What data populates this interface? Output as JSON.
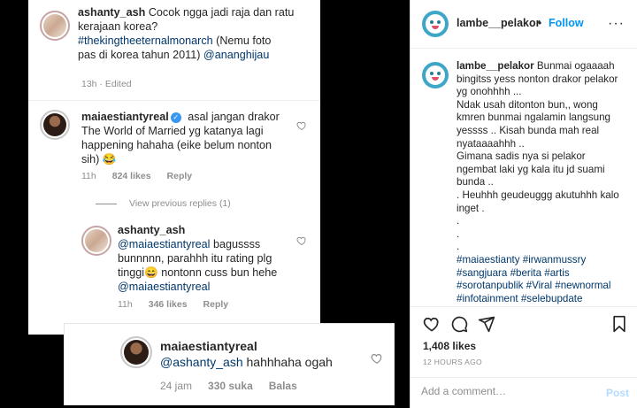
{
  "image_panel": {
    "comment1": {
      "username": "ashanty_ash",
      "text_line1": "Cocok ngga jadi raja dan ratu",
      "text_line2": "kerajaan korea?",
      "text_line3": "#thekingtheeternalmonarch",
      "text_line3b": "(Nemu foto",
      "text_line4": "pas di korea tahun 2011)",
      "mention": "@ananghijau",
      "meta": "13h · Edited"
    },
    "comment2": {
      "username": "maiaestiantyreal",
      "text_line1": "asal jangan drakor",
      "text_line2": "The World of Married yg katanya lagi",
      "text_line3": "happening hahaha (eike belum nonton",
      "text_line4": "sih) 😂",
      "time": "11h",
      "likes": "824 likes",
      "reply": "Reply"
    },
    "view_replies": "View previous replies (1)",
    "comment3": {
      "username": "ashanty_ash",
      "mention1": "@maiaestiantyreal",
      "text1": "bagussss",
      "text_line2": "bunnnnn, parahhh itu rating plg",
      "text_line3a": "tinggi😄",
      "text_line3b": "nontonn cuss bun hehe",
      "mention2": "@maiaestiantyreal",
      "time": "11h",
      "likes": "346 likes",
      "reply": "Reply"
    },
    "comment4": {
      "username": "maiaestiantyreal",
      "mention": "@ashanty_ash",
      "text": "hahhhaha ogah",
      "time": "24 jam",
      "likes": "330 suka",
      "reply": "Balas"
    }
  },
  "sidebar": {
    "username": "lambe__pelakor",
    "separator": "•",
    "follow_label": "Follow",
    "more": "···",
    "caption": {
      "username": "lambe__pelakor",
      "lines": [
        "Bunmai ogaaaah",
        "bingitss yess nonton drakor pelakor",
        "yg onohhhh ...",
        "Ndak usah ditonton bun,, wong",
        "kmren bunmai ngalamin langsung",
        "yessss .. Kisah bunda mah real",
        "nyataaaahhh ..",
        "Gimana sadis nya si pelakor",
        "ngembat laki yg kala itu jd suami",
        "bunda ..",
        ". Heuhhh geudeuggg akutuhhh kalo",
        "inget .",
        ".",
        ".",
        "."
      ],
      "hashtags": [
        "#maiaestianty #irwanmussry",
        "#sangjuara #berita #artis",
        "#sorotanpublik #Viral #newnormal",
        "#infotainment #selebupdate"
      ]
    },
    "likes": "1,408 likes",
    "time_ago": "12 HOURS AGO",
    "comment_placeholder": "Add a comment…",
    "post_label": "Post"
  },
  "colors": {
    "link": "#00376b",
    "follow": "#0095f6",
    "verified": "#3897f0",
    "meta_gray": "#8e8e8e"
  }
}
